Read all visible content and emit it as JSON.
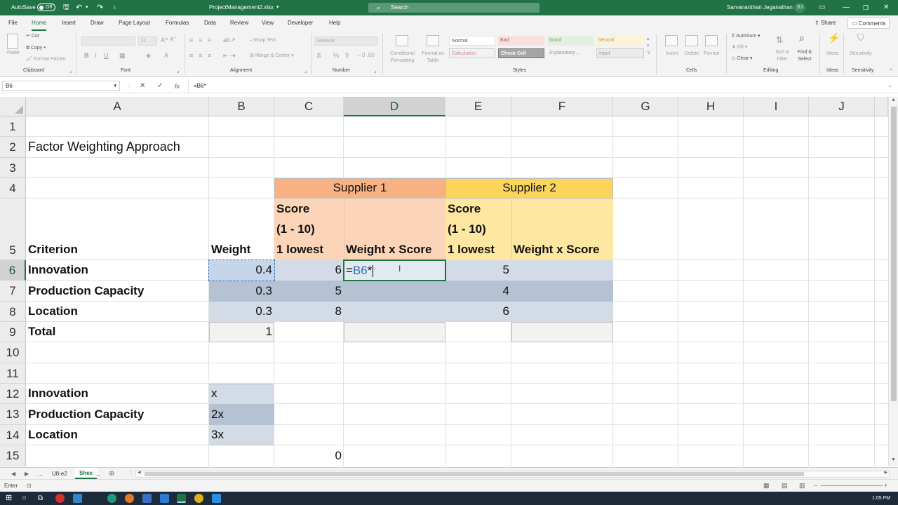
{
  "titlebar": {
    "autosave_label": "AutoSave",
    "autosave_state": "Off",
    "filename": "ProjectManagement2.xlsx",
    "search_placeholder": "Search",
    "user_name": "Sarvananthan Jeganathan",
    "user_initials": "SJ"
  },
  "ribbon_tabs": [
    "File",
    "Home",
    "Insert",
    "Draw",
    "Page Layout",
    "Formulas",
    "Data",
    "Review",
    "View",
    "Developer",
    "Help"
  ],
  "active_tab": "Home",
  "share_label": "Share",
  "comments_label": "Comments",
  "ribbon": {
    "clipboard": {
      "paste": "Paste",
      "cut": "Cut",
      "copy": "Copy",
      "format_painter": "Format Painter",
      "group": "Clipboard"
    },
    "font": {
      "size": "11",
      "group": "Font",
      "bold": "B",
      "italic": "I",
      "underline": "U"
    },
    "alignment": {
      "wrap_text": "Wrap Text",
      "merge_center": "Merge & Center",
      "group": "Alignment"
    },
    "number": {
      "format": "General",
      "group": "Number",
      "currency": "$",
      "percent": "%",
      "comma": "9"
    },
    "styles": {
      "conditional_formatting": "Conditional Formatting",
      "format_as_table": "Format as Table",
      "normal": "Normal",
      "bad": "Bad",
      "good": "Good",
      "neutral": "Neutral",
      "calculation": "Calculation",
      "check_cell": "Check Cell",
      "explanatory": "Explanatory ...",
      "input": "Input",
      "group": "Styles"
    },
    "cells": {
      "insert": "Insert",
      "delete": "Delete",
      "format": "Format",
      "group": "Cells"
    },
    "editing": {
      "autosum": "AutoSum",
      "fill": "Fill",
      "clear": "Clear",
      "sort_filter": "Sort & Filter",
      "find_select": "Find & Select",
      "group": "Editing"
    },
    "ideas": {
      "label": "Ideas",
      "group": "Ideas"
    },
    "sensitivity": {
      "label": "Sensitivity",
      "group": "Sensitivity"
    }
  },
  "formula_bar": {
    "name_box": "B6",
    "formula": "=B6*",
    "cancel": "✕",
    "enter": "✓",
    "fx": "fx"
  },
  "columns": [
    "A",
    "B",
    "C",
    "D",
    "E",
    "F",
    "G",
    "H",
    "I",
    "J"
  ],
  "rows": [
    "1",
    "2",
    "3",
    "4",
    "5",
    "6",
    "7",
    "8",
    "9",
    "10",
    "11",
    "12",
    "13",
    "14",
    "15"
  ],
  "cells": {
    "A2": "Factor Weighting Approach",
    "C4": "Supplier 1",
    "E4": "Supplier 2",
    "C5a": "Score",
    "C5b": "(1 - 10)",
    "C5c": "1 lowest",
    "D5": "Weight x Score",
    "E5a": "Score",
    "E5b": "(1 - 10)",
    "E5c": "1 lowest",
    "F5": "Weight x Score",
    "A5": "Criterion",
    "B5": "Weight",
    "A6": "Innovation",
    "B6": "0.4",
    "C6": "6",
    "D6_ref": "B6",
    "D6_op": "*",
    "E6": "5",
    "A7": "Production Capacity",
    "B7": "0.3",
    "C7": "5",
    "E7": "4",
    "A8": "Location",
    "B8": "0.3",
    "C8": "8",
    "E8": "6",
    "A9": "Total",
    "B9": "1",
    "A12": "Innovation",
    "B12": "x",
    "A13": "Production Capacity",
    "B13": "2x",
    "A14": "Location",
    "B14": "3x",
    "C15": "0"
  },
  "sheet_tabs": [
    "...",
    "U8-e2",
    "Shee",
    "..."
  ],
  "status": {
    "mode": "Enter"
  },
  "taskbar": {
    "time": "1:05 PM"
  },
  "colors": {
    "accent": "#217346",
    "supplier1": "#f8b183",
    "supplier1_light": "#fcd5b9",
    "supplier2": "#fbd45c",
    "supplier2_light": "#fee7a1",
    "sel_blue": "#c5d6ea"
  }
}
